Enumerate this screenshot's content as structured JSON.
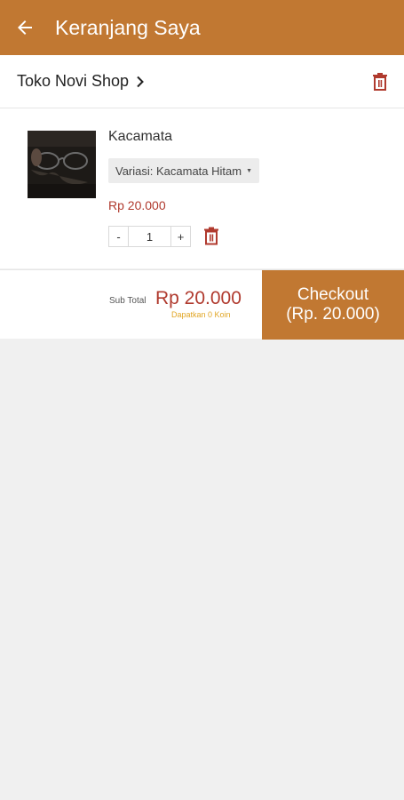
{
  "appbar": {
    "title": "Keranjang Saya",
    "back_icon": "arrow-left-icon"
  },
  "shop": {
    "name": "Toko Novi Shop",
    "chevron_icon": "chevron-right-icon",
    "delete_icon": "trash-icon"
  },
  "item": {
    "name": "Kacamata",
    "variant": "Variasi: Kacamata Hitam",
    "variant_caret": "▼",
    "price": "Rp 20.000",
    "qty_minus": "-",
    "qty_value": "1",
    "qty_plus": "+",
    "delete_icon": "trash-icon"
  },
  "footer": {
    "subtotal_label": "Sub Total",
    "subtotal_value": "Rp 20.000",
    "coins": "Dapatkan 0 Koin",
    "checkout_line1": "Checkout",
    "checkout_line2": "(Rp. 20.000)"
  },
  "colors": {
    "brand": "#c17832",
    "price": "#b03a2e",
    "coins": "#e1a626",
    "background": "#f0f0f0"
  }
}
